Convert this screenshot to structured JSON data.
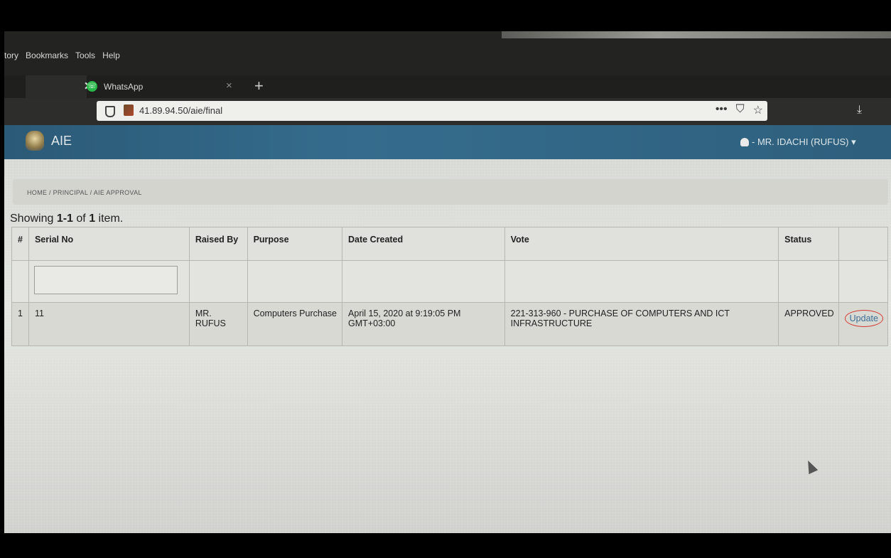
{
  "browser": {
    "menus": [
      "tory",
      "Bookmarks",
      "Tools",
      "Help"
    ],
    "tabs": [
      {
        "label": "",
        "close": "✕"
      },
      {
        "label": "WhatsApp",
        "close": "×"
      }
    ],
    "new_tab": "+",
    "url": "41.89.94.50/aie/final",
    "url_actions": [
      "•••",
      "⛉",
      "☆"
    ],
    "download_icon": "⤓"
  },
  "app": {
    "title": "AIE",
    "user": "- MR. IDACHI (RUFUS) ▾"
  },
  "breadcrumb": "HOME / PRINCIPAL / AIE APPROVAL",
  "summary": {
    "prefix": "Showing ",
    "range": "1-1",
    "middle": " of ",
    "total": "1",
    "suffix": " item."
  },
  "table": {
    "headers": [
      "#",
      "Serial No",
      "Raised By",
      "Purpose",
      "Date Created",
      "Vote",
      "Status",
      ""
    ],
    "rows": [
      {
        "index": "1",
        "serial": "11",
        "raised_by": "MR. RUFUS",
        "purpose": "Computers Purchase",
        "date_created": "April 15, 2020 at 9:19:05 PM GMT+03:00",
        "vote": "221-313-960 - PURCHASE OF COMPUTERS AND ICT INFRASTRUCTURE",
        "status": "APPROVED",
        "action": "Update"
      }
    ]
  },
  "colors": {
    "appbar": "#356c8d",
    "link": "#3d6f96",
    "annotation": "#d23b33"
  }
}
